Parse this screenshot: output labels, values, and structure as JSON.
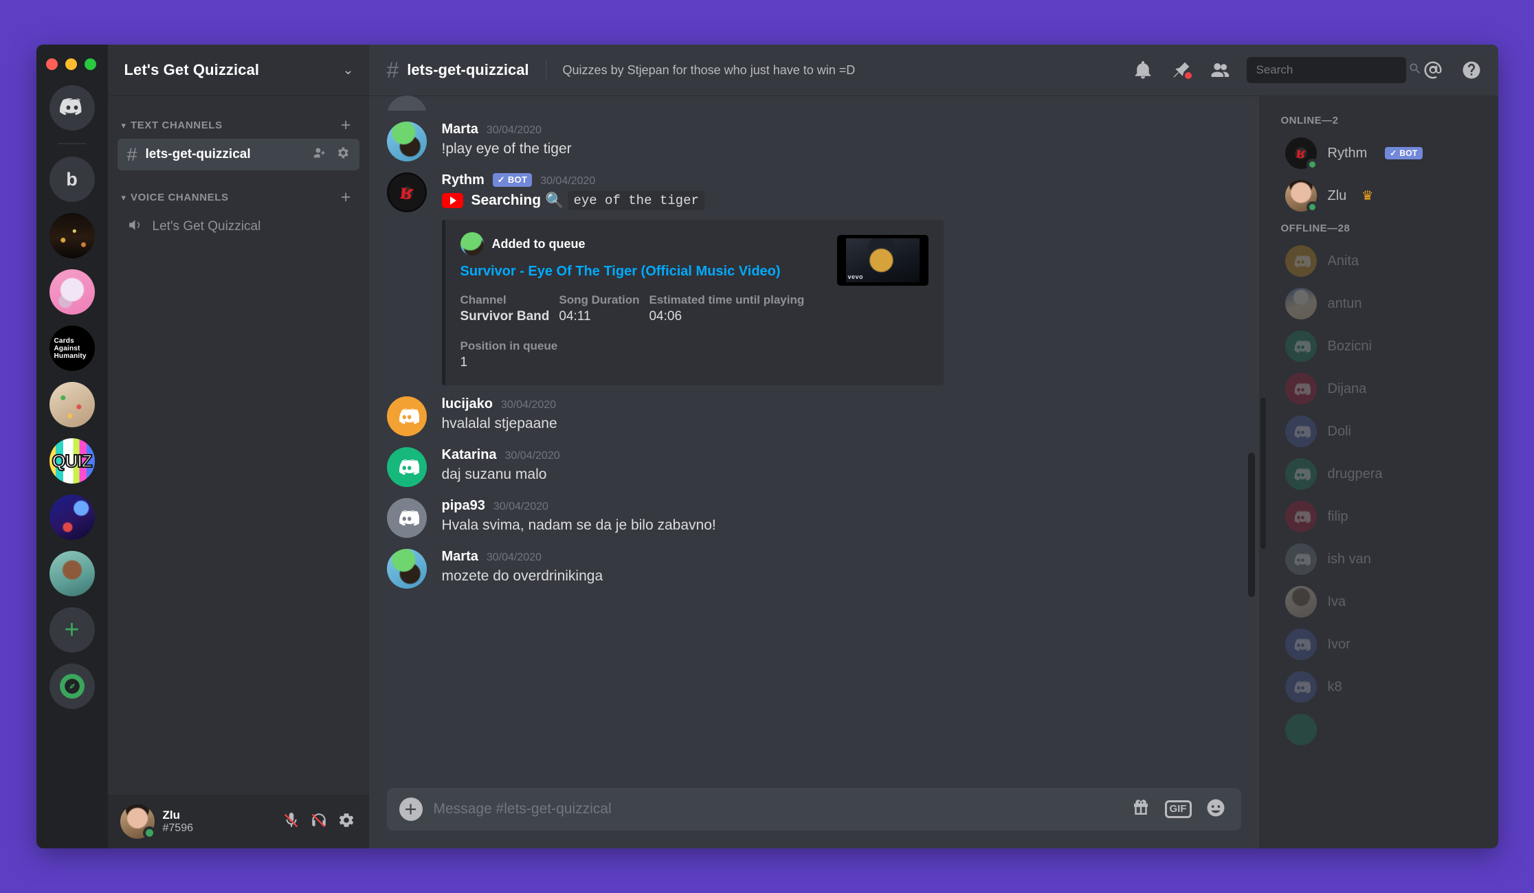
{
  "server_rail": {
    "icons": [
      {
        "name": "discord-home",
        "kind": "logo",
        "label": ""
      },
      {
        "name": "server-b",
        "kind": "letter",
        "label": "b"
      },
      {
        "name": "server-city",
        "kind": "art",
        "art": "art-city",
        "label": ""
      },
      {
        "name": "server-pink",
        "kind": "art",
        "art": "art-pink",
        "label": ""
      },
      {
        "name": "server-cards-against-humanity",
        "kind": "cah",
        "art": "art-cah",
        "label": "Cards Against Humanity"
      },
      {
        "name": "server-food",
        "kind": "art",
        "art": "art-food",
        "label": ""
      },
      {
        "name": "server-quiz",
        "kind": "quiz",
        "art": "art-quiz",
        "label": "QUIZ"
      },
      {
        "name": "server-blue-setup",
        "kind": "art",
        "art": "art-blue",
        "label": ""
      },
      {
        "name": "server-teal-portrait",
        "kind": "art",
        "art": "art-teal",
        "label": ""
      }
    ],
    "add_server_label": "+",
    "explore_label": "explore-servers"
  },
  "sidebar": {
    "guild_name": "Let's Get Quizzical",
    "categories": [
      {
        "name": "TEXT CHANNELS",
        "channels": [
          {
            "name": "lets-get-quizzical",
            "active": true,
            "type": "text"
          }
        ]
      },
      {
        "name": "VOICE CHANNELS",
        "channels": [
          {
            "name": "Let's Get Quizzical",
            "active": false,
            "type": "voice"
          }
        ]
      }
    ]
  },
  "user_panel": {
    "username": "Zlu",
    "discriminator": "#7596",
    "status": "online",
    "mute_label": "mute-microphone",
    "deafen_label": "deafen",
    "settings_label": "user-settings"
  },
  "top_bar": {
    "channel_name": "lets-get-quizzical",
    "topic": "Quizzes by Stjepan for those who just have to win =D",
    "search_placeholder": "Search",
    "search_value": ""
  },
  "messages": [
    {
      "id": "partial-top",
      "partial": true,
      "author": "",
      "timestamp": "",
      "text": ""
    },
    {
      "id": "m1",
      "author": "Marta",
      "timestamp": "30/04/2020",
      "text": "!play eye of the tiger",
      "avatar": "art-marta",
      "bot": false
    },
    {
      "id": "m2",
      "author": "Rythm",
      "timestamp": "30/04/2020",
      "bot": true,
      "bot_label": "BOT",
      "avatar": "art-rythm",
      "searching_label": "Searching",
      "search_query": "eye of the tiger",
      "embed": {
        "author_name": "Added to queue",
        "title": "Survivor - Eye Of The Tiger (Official Music Video)",
        "fields": [
          {
            "name": "Channel",
            "value": "Survivor Band",
            "bold": true
          },
          {
            "name": "Song Duration",
            "value": "04:11",
            "bold": false
          },
          {
            "name": "Estimated time until playing",
            "value": "04:06",
            "bold": false
          }
        ],
        "queue_field": {
          "name": "Position in queue",
          "value": "1"
        },
        "thumbnail_watermark": "vevo"
      }
    },
    {
      "id": "m3",
      "author": "lucijako",
      "timestamp": "30/04/2020",
      "text": "hvalalal stjepaane",
      "avatar": "av-orange",
      "bot": false
    },
    {
      "id": "m4",
      "author": "Katarina",
      "timestamp": "30/04/2020",
      "text": "daj suzanu malo",
      "avatar": "av-green",
      "bot": false
    },
    {
      "id": "m5",
      "author": "pipa93",
      "timestamp": "30/04/2020",
      "text": "Hvala svima, nadam se da je bilo zabavno!",
      "avatar": "av-grey",
      "bot": false
    },
    {
      "id": "m6",
      "author": "Marta",
      "timestamp": "30/04/2020",
      "text": "mozete do overdrinikinga",
      "avatar": "art-marta",
      "bot": false
    }
  ],
  "composer": {
    "placeholder": "Message #lets-get-quizzical",
    "value": "",
    "gif_label": "GIF"
  },
  "members": {
    "online_header": "ONLINE—2",
    "offline_header": "OFFLINE—28",
    "online": [
      {
        "name": "Rythm",
        "bot": true,
        "bot_label": "BOT",
        "avatar": "art-rythm",
        "crown": false
      },
      {
        "name": "Zlu",
        "bot": false,
        "avatar": "art-zlu",
        "crown": true,
        "crown_glyph": "♛"
      }
    ],
    "offline": [
      {
        "name": "Anita",
        "avatar": "av-amber"
      },
      {
        "name": "antun",
        "avatar": "art-antun"
      },
      {
        "name": "Bozicni",
        "avatar": "av-teal"
      },
      {
        "name": "Dijana",
        "avatar": "av-crim"
      },
      {
        "name": "Doli",
        "avatar": "av-indigo"
      },
      {
        "name": "drugpera",
        "avatar": "av-teal"
      },
      {
        "name": "filip",
        "avatar": "av-crim"
      },
      {
        "name": "ish van",
        "avatar": "av-slate"
      },
      {
        "name": "Iva",
        "avatar": "art-iva"
      },
      {
        "name": "Ivor",
        "avatar": "av-indigo"
      },
      {
        "name": "k8",
        "avatar": "av-indigo"
      },
      {
        "name": "",
        "avatar": "av-teal"
      }
    ]
  },
  "colors": {
    "desktop_purple": "#5d3fc4",
    "server_rail": "#202225",
    "sidebar": "#2f3136",
    "chat": "#36393f",
    "accent_blurple": "#7289da",
    "link_blue": "#00aaff",
    "online_green": "#3ba55d",
    "notification_red": "#ed4245",
    "crown_gold": "#faa61a"
  }
}
